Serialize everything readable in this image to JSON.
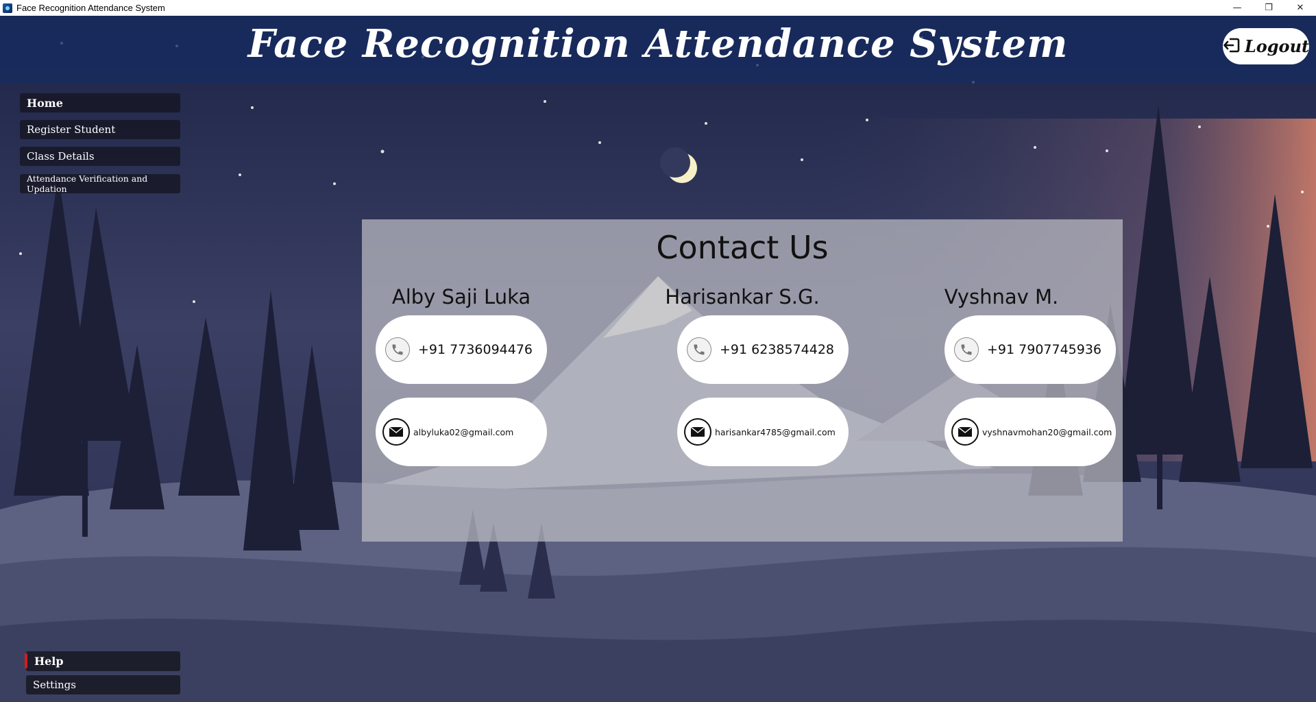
{
  "window": {
    "title": "Face Recognition Attendance System",
    "controls": {
      "minimize": "—",
      "restore": "❐",
      "close": "✕"
    }
  },
  "header": {
    "title": "Face Recognition Attendance System",
    "logout_label": "Logout",
    "logout_icon": "logout-icon"
  },
  "sidebar": {
    "items": [
      {
        "label": "Home"
      },
      {
        "label": "Register Student"
      },
      {
        "label": "Class Details"
      },
      {
        "label": "Attendance Verification and Updation"
      }
    ],
    "help_label": "Help",
    "settings_label": "Settings"
  },
  "contact": {
    "title": "Contact Us",
    "people": [
      {
        "name": "Alby Saji Luka",
        "phone": "+91 7736094476",
        "email": "albyluka02@gmail.com"
      },
      {
        "name": "Harisankar S.G.",
        "phone": "+91 6238574428",
        "email": "harisankar4785@gmail.com"
      },
      {
        "name": "Vyshnav M.",
        "phone": "+91 7907745936",
        "email": "vyshnavmohan20@gmail.com"
      }
    ]
  },
  "colors": {
    "header_bg": "#162c60",
    "panel_bg": "#bcbcc4",
    "help_marker": "#d61c1c"
  }
}
